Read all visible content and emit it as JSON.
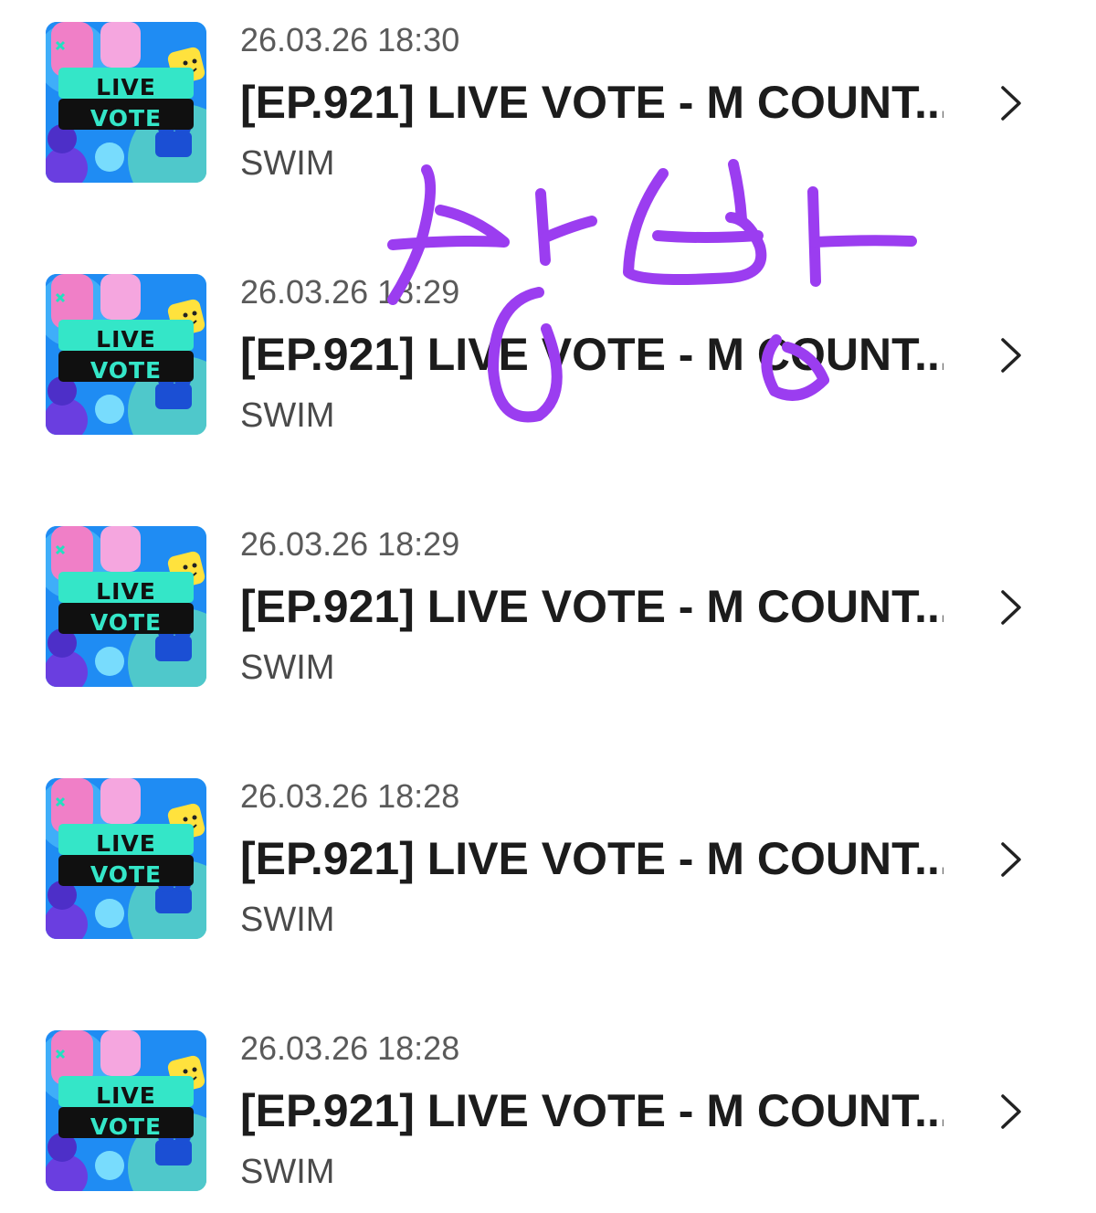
{
  "items": [
    {
      "thumb_line1": "LIVE",
      "thumb_line2": "VOTE",
      "date": "26.03.26 18:30",
      "title": "[EP.921] LIVE VOTE - M COUNT...",
      "subtitle": "SWIM"
    },
    {
      "thumb_line1": "LIVE",
      "thumb_line2": "VOTE",
      "date": "26.03.26 18:29",
      "title": "[EP.921] LIVE VOTE - M COUNT...",
      "subtitle": "SWIM"
    },
    {
      "thumb_line1": "LIVE",
      "thumb_line2": "VOTE",
      "date": "26.03.26 18:29",
      "title": "[EP.921] LIVE VOTE - M COUNT...",
      "subtitle": "SWIM"
    },
    {
      "thumb_line1": "LIVE",
      "thumb_line2": "VOTE",
      "date": "26.03.26 18:28",
      "title": "[EP.921] LIVE VOTE - M COUNT...",
      "subtitle": "SWIM"
    },
    {
      "thumb_line1": "LIVE",
      "thumb_line2": "VOTE",
      "date": "26.03.26 18:28",
      "title": "[EP.921] LIVE VOTE - M COUNT...",
      "subtitle": "SWIM"
    }
  ],
  "icons": {
    "row_chevron": "chevron-right-icon"
  },
  "colors": {
    "handwriting": "#9b3df0",
    "thumb_banner": "#34e6c8",
    "title_text": "#1c1c1c",
    "meta_text": "#5a5a5a"
  }
}
